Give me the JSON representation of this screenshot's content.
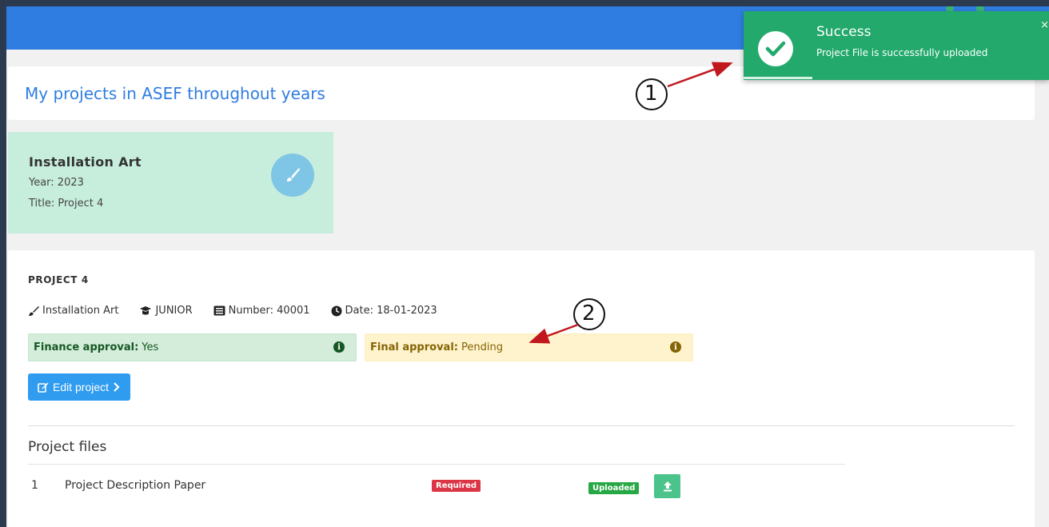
{
  "header": {
    "title": "My projects in ASEF throughout years"
  },
  "project_tile": {
    "category": "Installation Art",
    "year": "Year: 2023",
    "title": "Title: Project 4",
    "icon": "paintbrush-icon"
  },
  "project": {
    "heading": "PROJECT 4",
    "meta": {
      "category": "Installation Art",
      "level": "JUNIOR",
      "number": "Number: 40001",
      "date": "Date: 18-01-2023"
    },
    "finance_approval": {
      "label": "Finance approval:",
      "value": "Yes"
    },
    "final_approval": {
      "label": "Final approval:",
      "value": "Pending"
    },
    "edit_button": "Edit project"
  },
  "files": {
    "heading": "Project files",
    "rows": [
      {
        "index": "1",
        "name": "Project Description Paper",
        "required_badge": "Required",
        "status_badge": "Uploaded"
      }
    ]
  },
  "toast": {
    "title": "Success",
    "message": "Project File is successfully uploaded",
    "close": "×"
  },
  "annotations": {
    "one": "1",
    "two": "2"
  },
  "colors": {
    "primary": "#2f7de1",
    "toast_bg": "#22a96b",
    "tile_bg": "#c7eedd",
    "finance_bg": "#d4edda",
    "final_bg": "#fff3cd",
    "required": "#dc3545",
    "uploaded": "#28a745",
    "arrow": "#c0181d"
  }
}
